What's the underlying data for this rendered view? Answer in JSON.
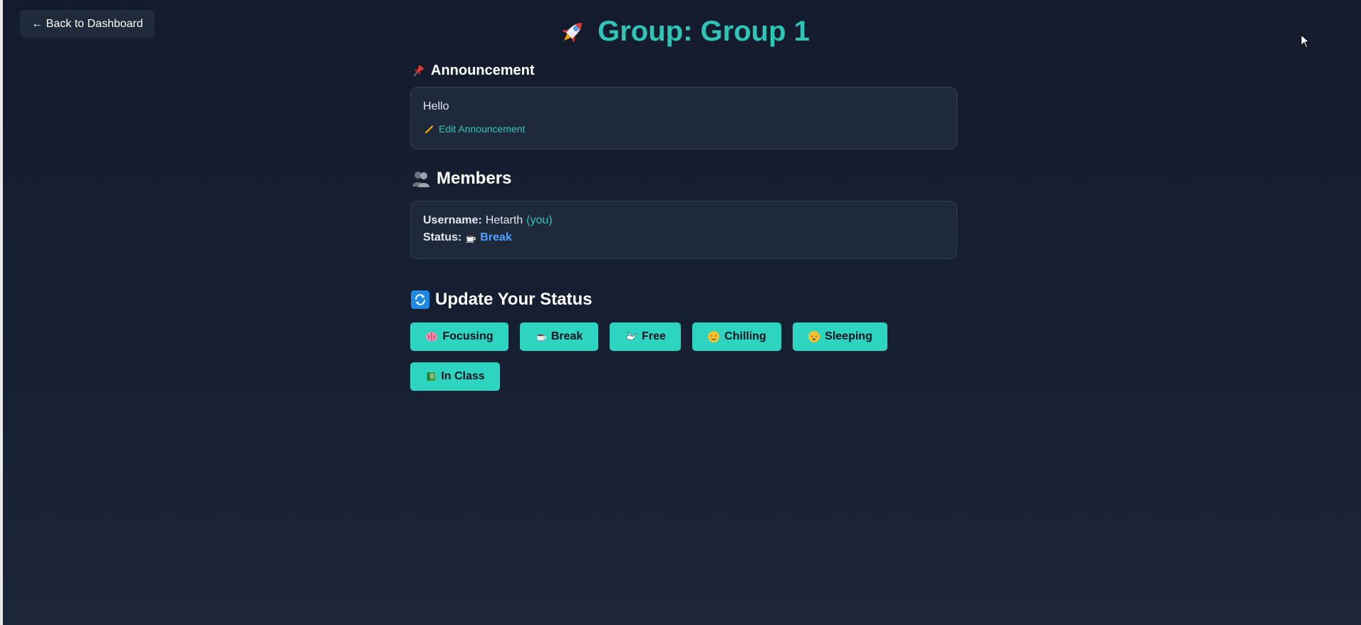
{
  "nav": {
    "back_label": "← Back to Dashboard"
  },
  "header": {
    "title": "Group: Group 1",
    "icon": "rocket-icon"
  },
  "announcement": {
    "heading": "Announcement",
    "icon": "pushpin-icon",
    "text": "Hello",
    "edit_label": "Edit Announcement",
    "edit_icon": "pencil-icon"
  },
  "members": {
    "heading": "Members",
    "icon": "people-icon",
    "list": [
      {
        "username_label": "Username:",
        "username": "Hetarth",
        "you_tag": "(you)",
        "status_label": "Status:",
        "status": "Break",
        "status_icon": "coffee-icon"
      }
    ]
  },
  "update_status": {
    "heading": "Update Your Status",
    "icon": "refresh-icon",
    "buttons": [
      {
        "label": "Focusing",
        "icon": "brain-icon"
      },
      {
        "label": "Break",
        "icon": "coffee-icon"
      },
      {
        "label": "Free",
        "icon": "dove-icon"
      },
      {
        "label": "Chilling",
        "icon": "relaxed-face-icon"
      },
      {
        "label": "Sleeping",
        "icon": "sleeping-face-icon"
      },
      {
        "label": "In Class",
        "icon": "book-icon"
      }
    ]
  },
  "colors": {
    "accent": "#2ec4b6",
    "button_bg": "#2dd4bf",
    "status_blue": "#4da3ff",
    "card_bg": "#1e293b",
    "page_bg": "#141b2d"
  }
}
